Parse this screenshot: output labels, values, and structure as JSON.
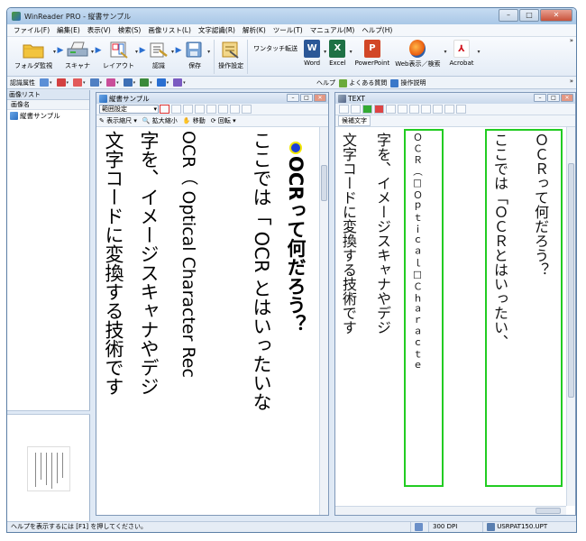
{
  "window": {
    "title": "WinReader PRO - 縦書サンプル",
    "min": "–",
    "max": "□",
    "close": "✕"
  },
  "menu": [
    "ファイル(F)",
    "編集(E)",
    "表示(V)",
    "検索(S)",
    "画像リスト(L)",
    "文字認識(R)",
    "解析(K)",
    "ツール(T)",
    "マニュアル(M)",
    "ヘルプ(H)"
  ],
  "toolbar": {
    "folder_watch": "フォルダ監視",
    "scanner": "スキャナ",
    "layout": "レイアウト",
    "recognize": "認識",
    "save": "保存",
    "op_settings": "操作設定",
    "onetouch": "ワンタッチ転送",
    "word": "Word",
    "excel": "Excel",
    "powerpoint": "PowerPoint",
    "web": "Web表示／検索",
    "acrobat": "Acrobat",
    "chevron": "»"
  },
  "toolbar2": {
    "attr_label": "認識属性",
    "help": "ヘルプ",
    "faq": "よくある質問",
    "ops": "操作説明",
    "chevron": "»"
  },
  "left_panel": {
    "header": "画像リスト",
    "column": "画像名",
    "item": "縦書サンプル"
  },
  "image_window": {
    "title": "縦書サンプル",
    "range_select": "範囲設定",
    "zoom_label": "表示縮尺",
    "enlarge": "拡大縮小",
    "move": "移動",
    "rotate": "回転",
    "columns": [
      "OCRって何だろう？",
      "ここでは「 OCR とはいったいな",
      "OCR（ Optical Character Rec",
      "字を、イメージスキャナやデジ",
      "文字コードに変換する技術です"
    ]
  },
  "text_window": {
    "title": "TEXT",
    "candidate": "候補文字",
    "columns": [
      "ＯＣＲって何だろう？",
      "ここでは「ＯＣＲとはいったい、",
      "ＯＣＲ（□Ｏｐｔｉｃａｌ□Ｃｈａｒａｃｔｅ",
      "字を、イメージスキャナやデジ",
      "文字コードに変換する技術です"
    ]
  },
  "status": {
    "hint": "ヘルプを表示するには [F1] を押してください。",
    "dpi": "300 DPI",
    "file": "USRPAT150.UPT"
  },
  "colors": {
    "green_box": "#22cc22",
    "accent": "#2a6fd1"
  }
}
